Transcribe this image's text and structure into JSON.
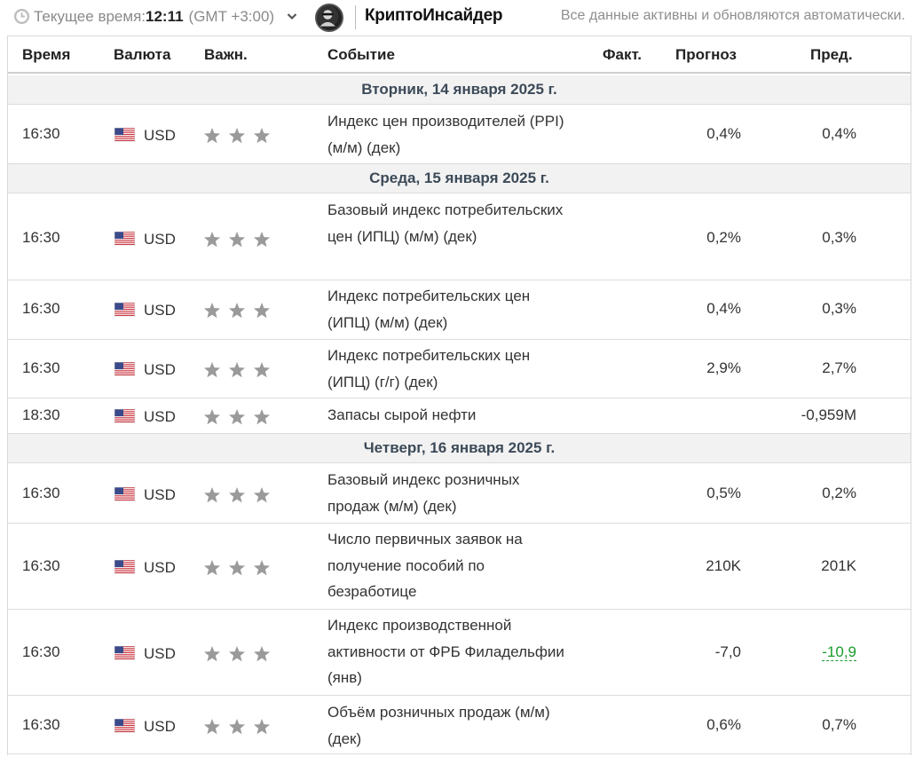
{
  "header_bar": {
    "time_label": "Текущее время:",
    "time_value": "12:11",
    "timezone": "(GMT +3:00)",
    "brand": "КриптоИнсайдер",
    "auto_update_note": "Все данные активны и обновляются автоматически."
  },
  "columns": {
    "time": "Время",
    "currency": "Валюта",
    "importance": "Важн.",
    "event": "Событие",
    "actual": "Факт.",
    "forecast": "Прогноз",
    "previous": "Пред."
  },
  "days": [
    {
      "label": "Вторник, 14 января 2025 г."
    },
    {
      "label": "Среда, 15 января 2025 г."
    },
    {
      "label": "Четверг, 16 января 2025 г."
    }
  ],
  "events": [
    {
      "time": "16:30",
      "currency": "USD",
      "importance_stars": 3,
      "event": "Индекс цен производителей (PPI) (м/м) (дек)",
      "actual": "",
      "forecast": "0,4%",
      "previous": "0,4%"
    },
    {
      "time": "16:30",
      "currency": "USD",
      "importance_stars": 3,
      "event": "Базовый индекс потребительских цен (ИПЦ) (м/м) (дек)",
      "actual": "",
      "forecast": "0,2%",
      "previous": "0,3%"
    },
    {
      "time": "16:30",
      "currency": "USD",
      "importance_stars": 3,
      "event": "Индекс потребительских цен (ИПЦ) (м/м) (дек)",
      "actual": "",
      "forecast": "0,4%",
      "previous": "0,3%"
    },
    {
      "time": "16:30",
      "currency": "USD",
      "importance_stars": 3,
      "event": "Индекс потребительских цен (ИПЦ) (г/г) (дек)",
      "actual": "",
      "forecast": "2,9%",
      "previous": "2,7%"
    },
    {
      "time": "18:30",
      "currency": "USD",
      "importance_stars": 3,
      "event": "Запасы сырой нефти",
      "actual": "",
      "forecast": "",
      "previous": "-0,959M"
    },
    {
      "time": "16:30",
      "currency": "USD",
      "importance_stars": 3,
      "event": "Базовый индекс розничных продаж (м/м) (дек)",
      "actual": "",
      "forecast": "0,5%",
      "previous": "0,2%"
    },
    {
      "time": "16:30",
      "currency": "USD",
      "importance_stars": 3,
      "event": "Число первичных заявок на получение пособий по безработице",
      "actual": "",
      "forecast": "210K",
      "previous": "201K"
    },
    {
      "time": "16:30",
      "currency": "USD",
      "importance_stars": 3,
      "event": "Индекс производственной активности от ФРБ Филадельфии (янв)",
      "actual": "",
      "forecast": "-7,0",
      "previous": "-10,9",
      "previous_status": "better"
    },
    {
      "time": "16:30",
      "currency": "USD",
      "importance_stars": 3,
      "event": "Объём розничных продаж (м/м) (дек)",
      "actual": "",
      "forecast": "0,6%",
      "previous": "0,7%"
    }
  ],
  "colors": {
    "day_bar": "#f2f2f2",
    "day_text": "#3c4a58",
    "star": "#9a9a9a",
    "positive": "#1a9c2c"
  }
}
